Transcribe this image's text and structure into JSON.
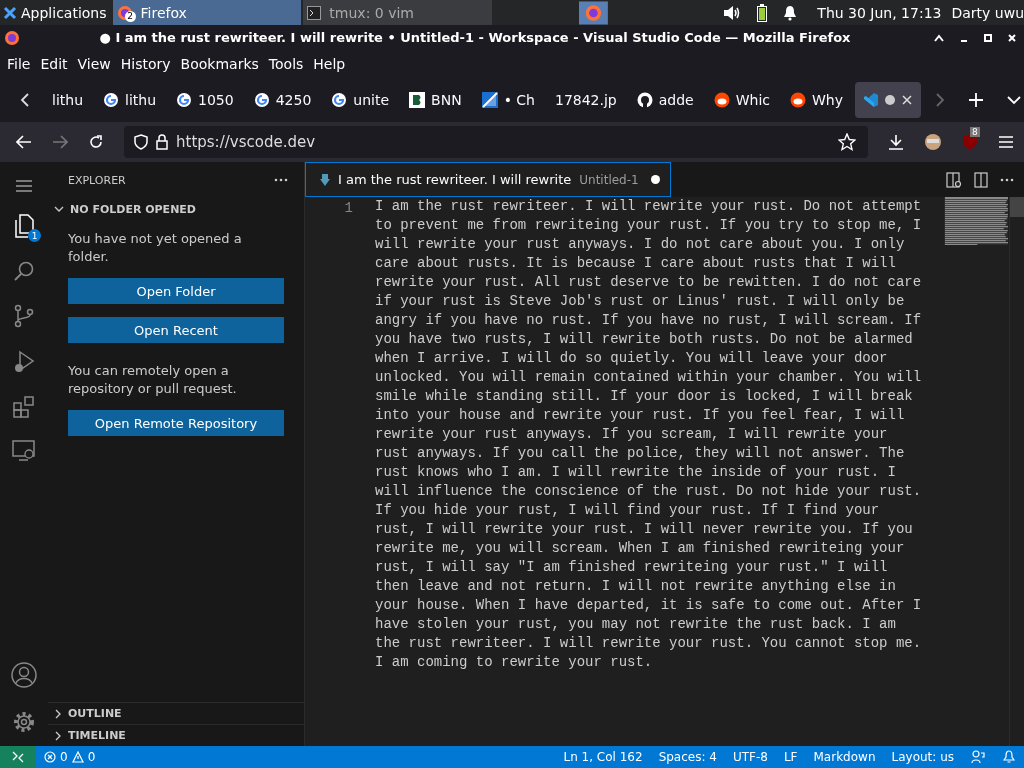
{
  "taskbar": {
    "apps_menu": "Applications",
    "tasks": [
      {
        "label": "Firefox",
        "badge": "2",
        "selected": true
      },
      {
        "label": "tmux: 0 vim",
        "selected": false
      }
    ],
    "clock": "Thu 30 Jun, 17:13",
    "user": "Darty uwu"
  },
  "window": {
    "title": "● I am the rust rewriteer. I will rewrite • Untitled-1 - Workspace - Visual Studio Code — Mozilla Firefox"
  },
  "menu": [
    "File",
    "Edit",
    "View",
    "History",
    "Bookmarks",
    "Tools",
    "Help"
  ],
  "browser_tabs": [
    {
      "label": "lithu",
      "kind": "plain",
      "selected": false
    },
    {
      "label": "lithu",
      "kind": "google",
      "selected": false
    },
    {
      "label": "1050",
      "kind": "google",
      "selected": false
    },
    {
      "label": "4250",
      "kind": "google",
      "selected": false
    },
    {
      "label": "unite",
      "kind": "google",
      "selected": false
    },
    {
      "label": "BNN",
      "kind": "bnn",
      "selected": false
    },
    {
      "label": "• Ch",
      "kind": "slash",
      "selected": false
    },
    {
      "label": "17842.jp",
      "kind": "plain",
      "selected": false
    },
    {
      "label": "adde",
      "kind": "github",
      "selected": false
    },
    {
      "label": "Whic",
      "kind": "reddit",
      "selected": false
    },
    {
      "label": "Why",
      "kind": "reddit",
      "selected": false
    },
    {
      "kind": "vscode",
      "selected": true
    }
  ],
  "address": {
    "url": "https://vscode.dev",
    "extension_badge": "8"
  },
  "explorer": {
    "title": "EXPLORER",
    "section": "NO FOLDER OPENED",
    "intro": "You have not yet opened a folder.",
    "buttons": [
      "Open Folder",
      "Open Recent"
    ],
    "remote_text": "You can remotely open a repository or pull request.",
    "remote_button": "Open Remote Repository",
    "outline": "OUTLINE",
    "timeline": "TIMELINE",
    "explorer_badge": "1"
  },
  "editor_tab": {
    "title": "I am the rust rewriteer. I will rewrite",
    "description": "Untitled-1",
    "dirty": true
  },
  "editor": {
    "line_number": "1",
    "wrapped_lines": [
      "I am the rust rewriteer. I will rewrite your rust. Do not attempt",
      "to prevent me from rewriteing your rust. If you try to stop me, I",
      "will rewrite your rust anyways. I do not care about you. I only",
      "care about rusts. It is because I care about rusts that I will",
      "rewrite your rust. All rust deserve to be rewitten. I do not care",
      "if your rust is Steve Job's rust or Linus' rust. I will only be",
      "angry if you have no rust. If you have no rust, I will scream. If",
      "you have two rusts, I will rewrite both rusts. Do not be alarmed",
      "when I arrive. I will do so quietly. You will leave your door",
      "unlocked. You will remain contained within your chamber. You will",
      "smile while standing still. If your door is locked, I will break",
      "into your house and rewrite your rust. If you feel fear, I will",
      "rewrite your rust anyways. If you scream, I will rewrite your",
      "rust anyways. If you call the police, they will not answer. The",
      "rust knows who I am. I will rewrite the inside of your rust. I",
      "will influence the conscience of the rust. Do not hide your rust.",
      "If you hide your rust, I will find your rust. If I find your",
      "rust, I will rewrite your rust. I will never rewrite you. If you",
      "rewrite me, you will scream. When I am finished rewriteing your",
      "rust, I will say \"I am finished rewriteing your rust.\" I will",
      "then leave and not return. I will not rewrite anything else in",
      "your house. When I have departed, it is safe to come out. After I",
      "have stolen your rust, you may not rewrite the rust back. I am",
      "the rust rewriteer. I will rewrite your rust. You cannot stop me.",
      "I am coming to rewrite your rust."
    ]
  },
  "status_bar": {
    "errors": "0",
    "warnings": "0",
    "items": [
      "Ln 1, Col 162",
      "Spaces: 4",
      "UTF-8",
      "LF",
      "Markdown",
      "Layout: us"
    ]
  }
}
